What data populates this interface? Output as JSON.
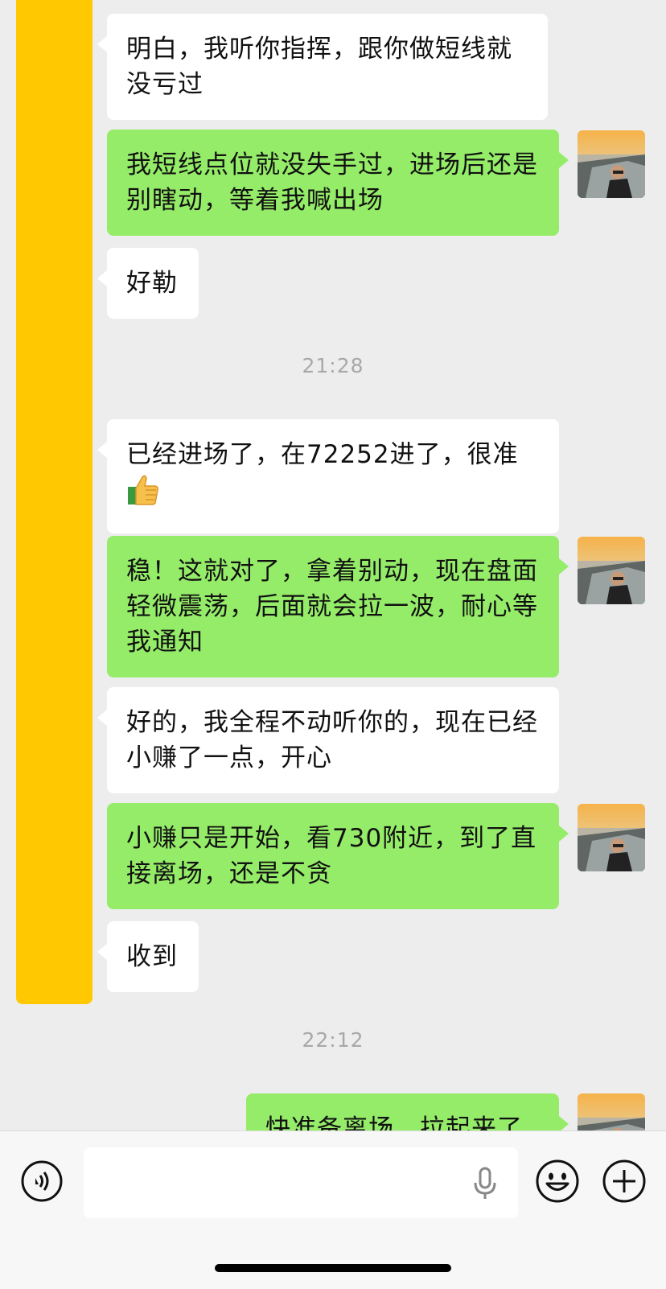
{
  "messages": [
    {
      "side": "in",
      "text": "明白，我听你指挥，跟你做短线就没亏过"
    },
    {
      "side": "out",
      "text": "我短线点位就没失手过，进场后还是别瞎动，等着我喊出场"
    },
    {
      "side": "in",
      "text": "好勒"
    },
    {
      "side": "in",
      "text": "已经进场了，在72252进了，很准"
    },
    {
      "side": "out",
      "text": "稳！这就对了，拿着别动，现在盘面轻微震荡，后面就会拉一波，耐心等我通知"
    },
    {
      "side": "in",
      "text": "好的，我全程不动听你的，现在已经小赚了一点，开心"
    },
    {
      "side": "out",
      "text": "小赚只是开始，看730附近，到了直接离场，还是不贪"
    },
    {
      "side": "in",
      "text": "收到"
    },
    {
      "side": "out",
      "text": "快准备离场，拉起来了"
    }
  ],
  "timestamps": [
    "21:28",
    "22:12"
  ],
  "emoji": {
    "thumbs_up": "thumbs-up-emoji"
  },
  "input": {
    "placeholder": ""
  },
  "colors": {
    "background": "#ededed",
    "incoming_bubble": "#ffffff",
    "outgoing_bubble": "#95ec69",
    "overlay_bar": "#ffc800",
    "timestamp": "#a8a8a8"
  }
}
